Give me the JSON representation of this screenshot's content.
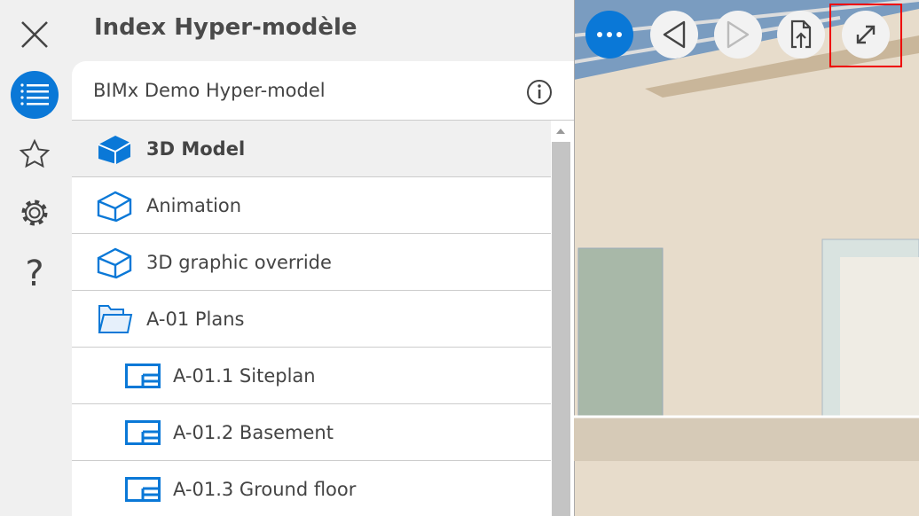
{
  "rail": {
    "items": [
      "close-icon",
      "list-icon",
      "star-icon",
      "gear-icon",
      "help-icon"
    ],
    "active_color": "#0a78d7"
  },
  "panel": {
    "title": "Index Hyper-modèle",
    "header": "BIMx Demo Hyper-model"
  },
  "items": [
    {
      "label": "3D Model",
      "icon": "model-filled-icon",
      "selected": true
    },
    {
      "label": "Animation",
      "icon": "model-icon"
    },
    {
      "label": "3D graphic override",
      "icon": "model-icon"
    },
    {
      "label": "A-01 Plans",
      "icon": "folder-icon"
    },
    {
      "label": "A-01.1 Siteplan",
      "icon": "plan-icon"
    },
    {
      "label": "A-01.2 Basement",
      "icon": "plan-icon"
    },
    {
      "label": "A-01.3 Ground floor",
      "icon": "plan-icon"
    }
  ],
  "toolbar": [
    "more-icon",
    "back-icon",
    "forward-icon",
    "export-icon",
    "fullscreen-icon"
  ]
}
